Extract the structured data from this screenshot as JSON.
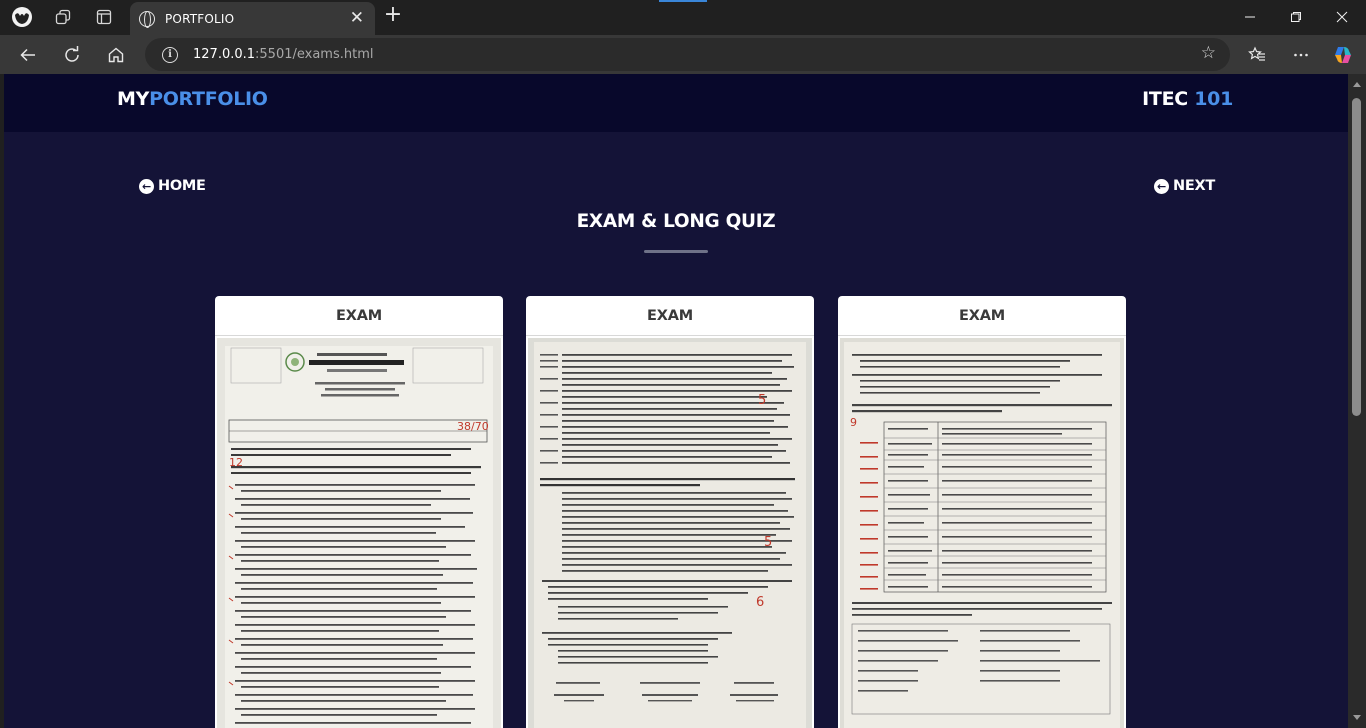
{
  "browser": {
    "tab_title": "PORTFOLIO",
    "address_host": "127.0.0.1",
    "address_rest": ":5501/exams.html"
  },
  "header": {
    "logo_my": "MY",
    "logo_portfolio": "PORTFOLIO",
    "course_prefix": "ITEC ",
    "course_number": "101"
  },
  "nav": {
    "home_label": "HOME",
    "next_label": "NEXT"
  },
  "page_title": "EXAM & LONG QUIZ",
  "cards": [
    {
      "title": "EXAM"
    },
    {
      "title": "EXAM"
    },
    {
      "title": "EXAM"
    }
  ],
  "colors": {
    "page_bg": "#141337",
    "header_bg": "#08082b",
    "accent_blue": "#4a8fe8",
    "browser_bg": "#202020",
    "toolbar_bg": "#383838"
  }
}
